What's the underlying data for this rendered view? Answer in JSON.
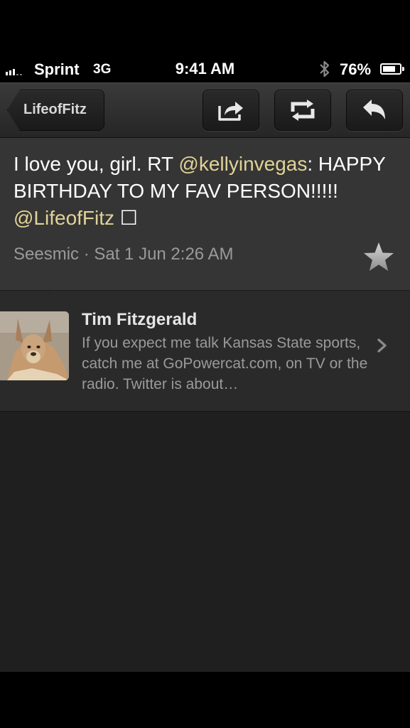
{
  "status_bar": {
    "carrier": "Sprint",
    "network": "3G",
    "time": "9:41 AM",
    "battery": "76%",
    "battery_level": 0.76,
    "icons": [
      "signal-icon",
      "bluetooth-icon",
      "battery-icon"
    ]
  },
  "nav": {
    "back_label": "LifeofFitz",
    "actions": [
      "share-icon",
      "retweet-icon",
      "reply-icon"
    ]
  },
  "tweet": {
    "text_before": "I love you, girl. RT ",
    "mention_1": "@kellyinvegas",
    "text_middle": ": HAPPY BIRTHDAY TO MY FAV PERSON!!!!! ",
    "mention_2": "@LifeofFitz",
    "text_after": " ☐",
    "source": "Seesmic",
    "separator": " · ",
    "timestamp": "Sat 1 Jun 2:26 AM"
  },
  "profile": {
    "name": "Tim Fitzgerald",
    "bio": "If you expect me talk Kansas State sports, catch me at GoPowercat.com, on TV or the radio. Twitter is about…"
  },
  "colors": {
    "mention": "#e2d296",
    "tweet_bg": "#353535",
    "profile_bg": "#2a2a2a",
    "meta_text": "#9a9a9a"
  }
}
